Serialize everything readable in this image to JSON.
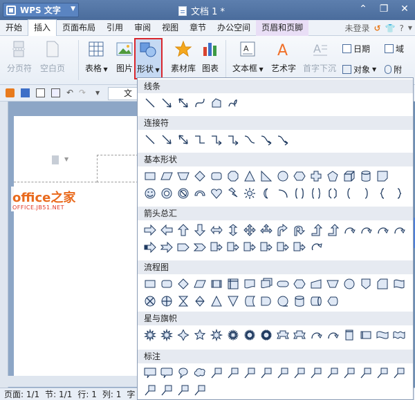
{
  "titlebar": {
    "app_name": "WPS 文字",
    "doc_title": "文档 1 *",
    "minimize": "⌃",
    "restore": "❐",
    "close": "✕"
  },
  "menu": {
    "items": [
      "开始",
      "插入",
      "页面布局",
      "引用",
      "审阅",
      "视图",
      "章节",
      "办公空间",
      "页眉和页脚"
    ],
    "active": "插入",
    "login": "未登录",
    "help": "?"
  },
  "ribbon": {
    "page_break": "分页符",
    "blank_page": "空白页",
    "table": "表格",
    "picture": "图片",
    "shapes": "形状",
    "material": "素材库",
    "chart": "图表",
    "textbox": "文本框",
    "wordart": "艺术字",
    "dropcap": "首字下沉",
    "date": "日期",
    "object": "对象",
    "field": "域",
    "attach": "附"
  },
  "qbar": {
    "doc_tab": "文"
  },
  "watermark": {
    "main": "office之家",
    "sub": "OFFICE.JB51.NET"
  },
  "status": {
    "page": "页面: 1/1",
    "section": "节: 1/1",
    "row": "行: 1",
    "col": "列: 1",
    "char": "字"
  },
  "dropdown": {
    "sections": [
      {
        "title": "线条",
        "rows": [
          [
            "line",
            "arrow",
            "double-arrow",
            "curve",
            "freeform",
            "scribble"
          ]
        ]
      },
      {
        "title": "连接符",
        "rows": [
          [
            "straight-connector",
            "straight-arrow-connector",
            "straight-double-arrow-connector",
            "elbow-connector",
            "elbow-arrow-connector",
            "elbow-double-arrow-connector",
            "curved-connector",
            "curved-arrow-connector",
            "curved-double-arrow-connector"
          ]
        ]
      },
      {
        "title": "基本形状",
        "rows": [
          [
            "rectangle",
            "parallelogram",
            "trapezoid",
            "diamond",
            "rounded-rectangle",
            "octagon",
            "triangle",
            "right-triangle",
            "circle",
            "hexagon",
            "plus",
            "pentagon",
            "cube",
            "can",
            "folded-corner"
          ],
          [
            "smiley",
            "donut",
            "no-symbol",
            "block-arc",
            "heart",
            "lightning",
            "sun",
            "moon",
            "arc",
            "double-bracket",
            "double-brace",
            "octagon-bracket",
            "left-bracket",
            "right-bracket",
            "left-brace",
            "right-brace"
          ]
        ]
      },
      {
        "title": "箭头总汇",
        "rows": [
          [
            "right-arrow",
            "left-arrow",
            "up-arrow",
            "down-arrow",
            "left-right-arrow",
            "up-down-arrow",
            "quad-arrow",
            "left-right-up-arrow",
            "bent-arrow",
            "u-turn-arrow",
            "left-up-arrow",
            "bent-up-arrow",
            "curved-right-arrow",
            "curved-left-arrow",
            "curved-up-arrow",
            "curved-down-arrow"
          ],
          [
            "striped-right-arrow",
            "notched-right-arrow",
            "pentagon-arrow",
            "chevron",
            "right-arrow-callout",
            "left-arrow-callout",
            "down-arrow-callout",
            "up-down-arrow-callout",
            "left-right-arrow-callout",
            "quad-arrow-callout",
            "circular-arrow"
          ]
        ]
      },
      {
        "title": "流程图",
        "rows": [
          [
            "process",
            "alternate-process",
            "decision",
            "data",
            "predefined-process",
            "internal-storage",
            "document",
            "multidocument",
            "terminator",
            "preparation",
            "manual-input",
            "manual-operation",
            "connector",
            "off-page-connector",
            "card",
            "punched-tape"
          ],
          [
            "summing-junction",
            "or",
            "collate",
            "sort",
            "extract",
            "merge",
            "stored-data",
            "delay",
            "sequential-access-storage",
            "magnetic-disk",
            "direct-access-storage",
            "display"
          ]
        ]
      },
      {
        "title": "星与旗帜",
        "rows": [
          [
            "explosion-1",
            "explosion-2",
            "4-point-star",
            "5-point-star",
            "8-point-star",
            "16-point-star",
            "24-point-star",
            "32-point-star",
            "up-ribbon",
            "down-ribbon",
            "curved-up-ribbon",
            "curved-down-ribbon",
            "vertical-scroll",
            "horizontal-scroll",
            "wave",
            "double-wave"
          ]
        ]
      },
      {
        "title": "标注",
        "rows": [
          [
            "rectangular-callout",
            "rounded-rectangular-callout",
            "oval-callout",
            "cloud-callout",
            "line-callout-1",
            "line-callout-2",
            "line-callout-3",
            "line-callout-4",
            "line-callout-1-accent",
            "line-callout-2-accent",
            "line-callout-3-accent",
            "line-callout-4-accent",
            "line-callout-1-no-border",
            "line-callout-2-no-border",
            "line-callout-3-no-border",
            "line-callout-4-no-border"
          ],
          [
            "line-callout-1-border-accent",
            "line-callout-2-border-accent",
            "line-callout-3-border-accent",
            "line-callout-4-border-accent"
          ]
        ]
      }
    ]
  },
  "colors": {
    "title_bg": "#4a6c9c",
    "selected_border": "#d9262c",
    "section_bg": "#e6eaf1",
    "shape_stroke": "#1f3a60",
    "shape_fill": "#dfe8f5"
  }
}
